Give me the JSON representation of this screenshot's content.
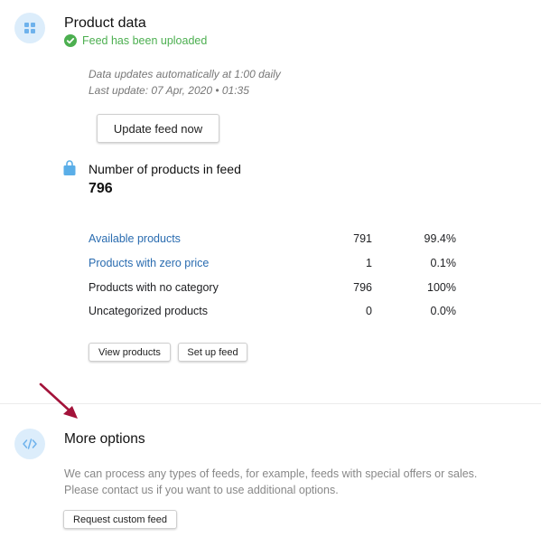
{
  "product_data": {
    "title": "Product data",
    "status": "Feed has been uploaded",
    "update_schedule": "Data updates automatically at 1:00 daily",
    "last_update": "Last update: 07 Apr, 2020 • 01:35",
    "update_button": "Update feed now",
    "count_label": "Number of products in feed",
    "count_value": "796",
    "rows": [
      {
        "label": "Available products",
        "count": "791",
        "percent": "99.4%",
        "link": true
      },
      {
        "label": "Products with zero price",
        "count": "1",
        "percent": "0.1%",
        "link": true
      },
      {
        "label": "Products with no category",
        "count": "796",
        "percent": "100%",
        "link": false
      },
      {
        "label": "Uncategorized products",
        "count": "0",
        "percent": "0.0%",
        "link": false
      }
    ],
    "view_products_button": "View products",
    "set_up_feed_button": "Set up feed"
  },
  "more_options": {
    "title": "More options",
    "description_line1": "We can process any types of feeds, for example, feeds with special offers or sales.",
    "description_line2": "Please contact us if you want to use additional options.",
    "request_button": "Request custom feed"
  },
  "icons": {
    "product_data": "grid-icon",
    "status": "check-circle-icon",
    "count": "shopping-bag-icon",
    "more_options": "code-icon",
    "annotation": "red-arrow-icon"
  },
  "colors": {
    "accent_blue": "#2a6cb0",
    "success_green": "#4caf50",
    "icon_circle": "#dcedfb",
    "annotation_arrow": "#a3133a"
  }
}
